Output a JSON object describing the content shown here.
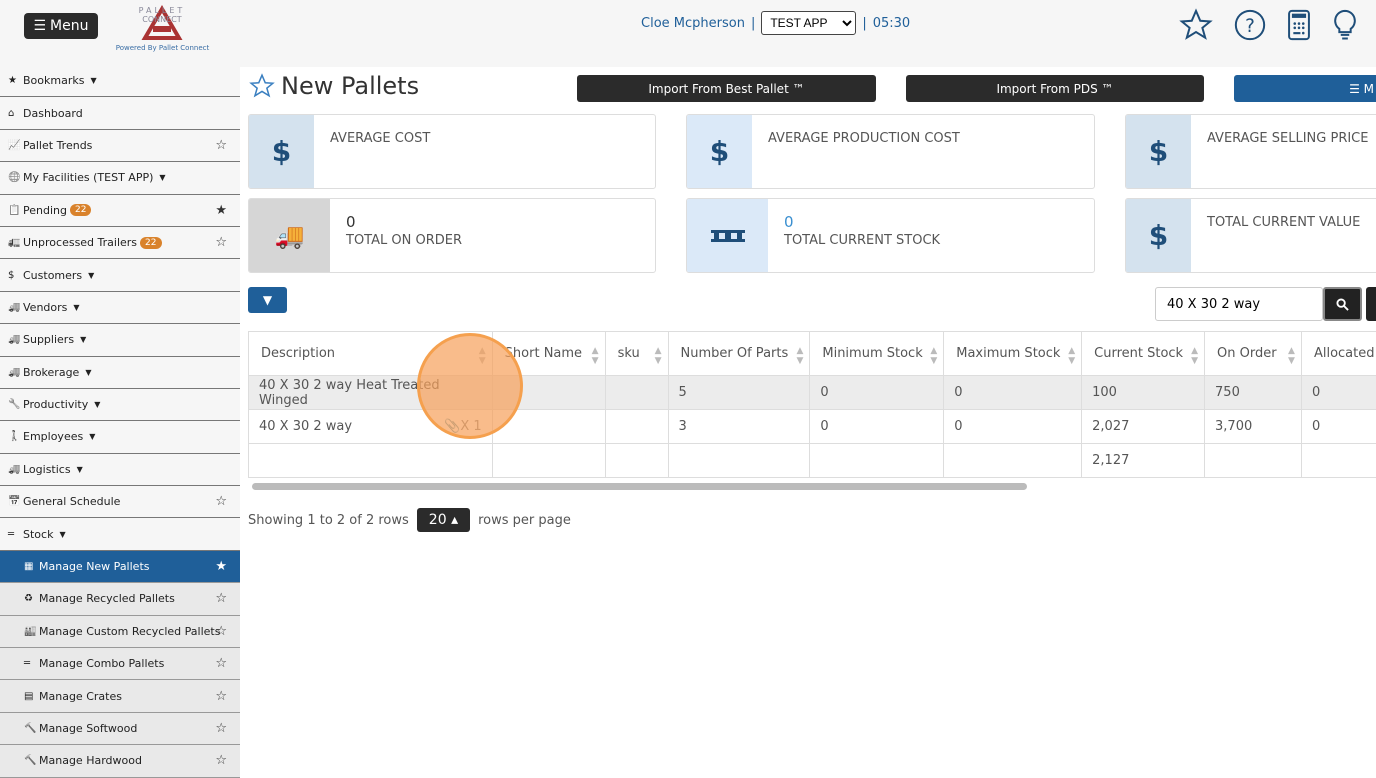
{
  "header": {
    "menu_label": "Menu",
    "logo_text": "PALLET CONNECT TEST",
    "logo_tagline": "Powered By Pallet Connect",
    "user": "Cloe Mcpherson",
    "app_select": "TEST APP",
    "time": "05:30",
    "icons": [
      "star-icon",
      "help-icon",
      "calculator-icon",
      "lightbulb-icon"
    ]
  },
  "sidebar": {
    "items": [
      {
        "label": "Bookmarks",
        "icon": "star-icon",
        "caret": true
      },
      {
        "label": "Dashboard",
        "icon": "home-icon"
      },
      {
        "label": "Pallet Trends",
        "icon": "chart-icon",
        "star": "empty"
      },
      {
        "label": "My Facilities (TEST APP)",
        "icon": "globe-icon",
        "caret": true
      },
      {
        "label": "Pending",
        "icon": "clipboard-icon",
        "badge": "22",
        "star": "filled"
      },
      {
        "label": "Unprocessed Trailers",
        "icon": "trailer-icon",
        "badge": "22",
        "star": "empty"
      },
      {
        "label": "Customers",
        "icon": "dollar-icon",
        "caret": true
      },
      {
        "label": "Vendors",
        "icon": "truck-icon",
        "caret": true
      },
      {
        "label": "Suppliers",
        "icon": "truck-icon",
        "caret": true
      },
      {
        "label": "Brokerage",
        "icon": "truck-icon",
        "caret": true
      },
      {
        "label": "Productivity",
        "icon": "wrench-icon",
        "caret": true
      },
      {
        "label": "Employees",
        "icon": "person-icon",
        "caret": true
      },
      {
        "label": "Logistics",
        "icon": "truck-icon",
        "caret": true
      },
      {
        "label": "General Schedule",
        "icon": "calendar-icon",
        "star": "empty"
      },
      {
        "label": "Stock",
        "icon": "pallet-icon",
        "caret": true
      },
      {
        "label": "Manage New Pallets",
        "icon": "pallets-icon",
        "star": "filled",
        "sub": true,
        "active": true
      },
      {
        "label": "Manage Recycled Pallets",
        "icon": "recycle-icon",
        "star": "empty",
        "sub": true
      },
      {
        "label": "Manage Custom Recycled Pallets",
        "icon": "industry-icon",
        "star": "empty",
        "sub": true
      },
      {
        "label": "Manage Combo Pallets",
        "icon": "pallet-icon",
        "star": "empty",
        "sub": true
      },
      {
        "label": "Manage Crates",
        "icon": "crate-icon",
        "star": "empty",
        "sub": true
      },
      {
        "label": "Manage Softwood",
        "icon": "hammer-icon",
        "star": "empty",
        "sub": true
      },
      {
        "label": "Manage Hardwood",
        "icon": "hammer-icon",
        "star": "empty",
        "sub": true
      }
    ]
  },
  "page": {
    "title": "New Pallets",
    "buttons": [
      "Import From Best Pallet ™",
      "Import From PDS ™",
      "☰ M"
    ]
  },
  "cards": [
    {
      "label": "AVERAGE COST",
      "value": "",
      "icon": "dollar-icon"
    },
    {
      "label": "AVERAGE PRODUCTION COST",
      "value": "",
      "icon": "dollar-icon"
    },
    {
      "label": "AVERAGE SELLING PRICE",
      "value": "",
      "icon": "dollar-icon"
    },
    {
      "label": "TOTAL ON ORDER",
      "value": "0",
      "icon": "truck-icon"
    },
    {
      "label": "TOTAL CURRENT STOCK",
      "value": "0",
      "icon": "pallet-icon"
    },
    {
      "label": "TOTAL CURRENT VALUE",
      "value": "",
      "icon": "dollar-icon"
    }
  ],
  "search": {
    "value": "40 X 30 2 way"
  },
  "table": {
    "columns": [
      "Description",
      "Short Name",
      "sku",
      "Number Of Parts",
      "Minimum Stock",
      "Maximum Stock",
      "Current Stock",
      "On Order",
      "Allocated"
    ],
    "rows": [
      [
        "40 X 30 2 way Heat Treated Winged",
        "",
        "",
        "5",
        "0",
        "0",
        "100",
        "750",
        "0"
      ],
      [
        "40 X 30 2 way",
        "",
        "",
        "3",
        "0",
        "0",
        "2,027",
        "3,700",
        "0"
      ]
    ],
    "row_attachment": "X 1",
    "totals": [
      "",
      "",
      "",
      "",
      "",
      "",
      "2,127",
      "",
      ""
    ]
  },
  "pager": {
    "showing": "Showing 1 to 2 of 2 rows",
    "page_size": "20",
    "suffix": "rows per page"
  }
}
